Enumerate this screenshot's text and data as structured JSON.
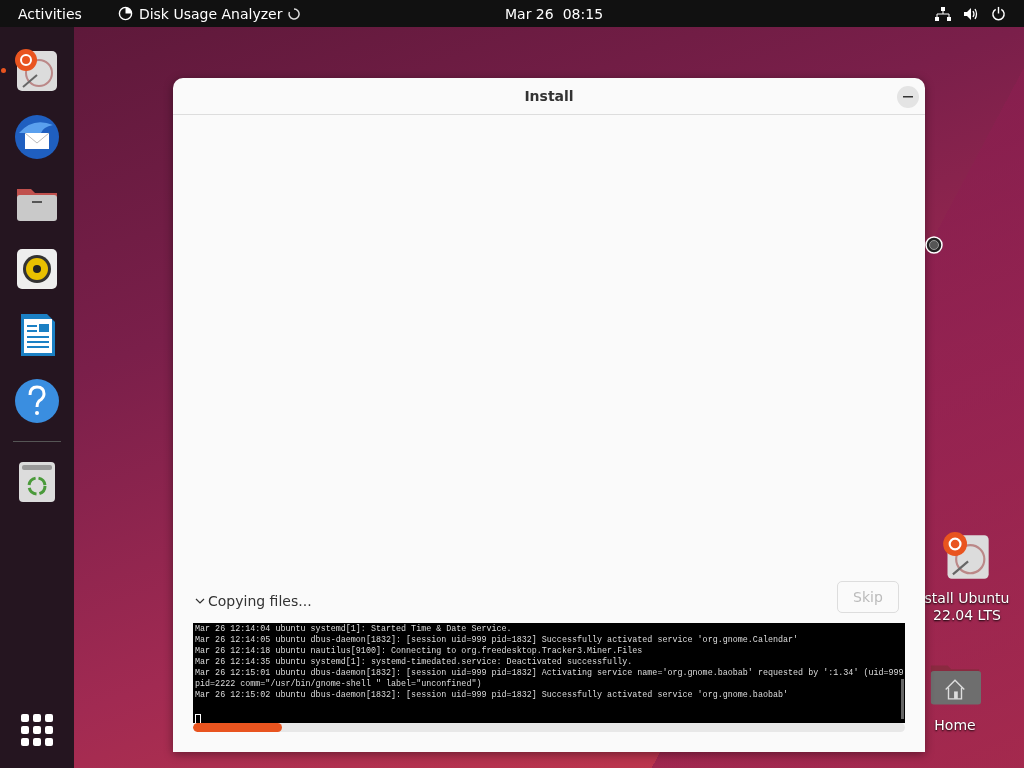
{
  "top_bar": {
    "activities": "Activities",
    "app_name": "Disk Usage Analyzer",
    "busy": true,
    "date": "Mar 26",
    "time": "08:15"
  },
  "dock": {
    "items": [
      {
        "kind": "installer",
        "running": true
      },
      {
        "kind": "mail",
        "running": false
      },
      {
        "kind": "files",
        "running": false
      },
      {
        "kind": "music",
        "running": false
      },
      {
        "kind": "writer",
        "running": false
      },
      {
        "kind": "help",
        "running": false
      },
      {
        "kind": "trash",
        "running": false
      }
    ]
  },
  "desktop_icons": [
    {
      "kind": "installer",
      "label_lines": [
        "stall Ubuntu",
        "22.04 LTS"
      ]
    },
    {
      "kind": "home",
      "label_lines": [
        "Home"
      ]
    }
  ],
  "window": {
    "title": "Install",
    "section": {
      "label": "Copying files...",
      "expanded": true
    },
    "skip_button": {
      "label": "Skip",
      "disabled": true
    },
    "log_lines": [
      "Mar 26 12:14:04 ubuntu systemd[1]: Started Time & Date Service.",
      "Mar 26 12:14:05 ubuntu dbus-daemon[1832]: [session uid=999 pid=1832] Successfully activated service 'org.gnome.Calendar'",
      "Mar 26 12:14:18 ubuntu nautilus[9100]: Connecting to org.freedesktop.Tracker3.Miner.Files",
      "Mar 26 12:14:35 ubuntu systemd[1]: systemd-timedated.service: Deactivated successfully.",
      "Mar 26 12:15:01 ubuntu dbus-daemon[1832]: [session uid=999 pid=1832] Activating service name='org.gnome.baobab' requested by ':1.34' (uid=999",
      "pid=2222 comm=\"/usr/bin/gnome-shell \" label=\"unconfined\")",
      "Mar 26 12:15:02 ubuntu dbus-daemon[1832]: [session uid=999 pid=1832] Successfully activated service 'org.gnome.baobab'"
    ],
    "progress": {
      "level": 0.125
    }
  }
}
